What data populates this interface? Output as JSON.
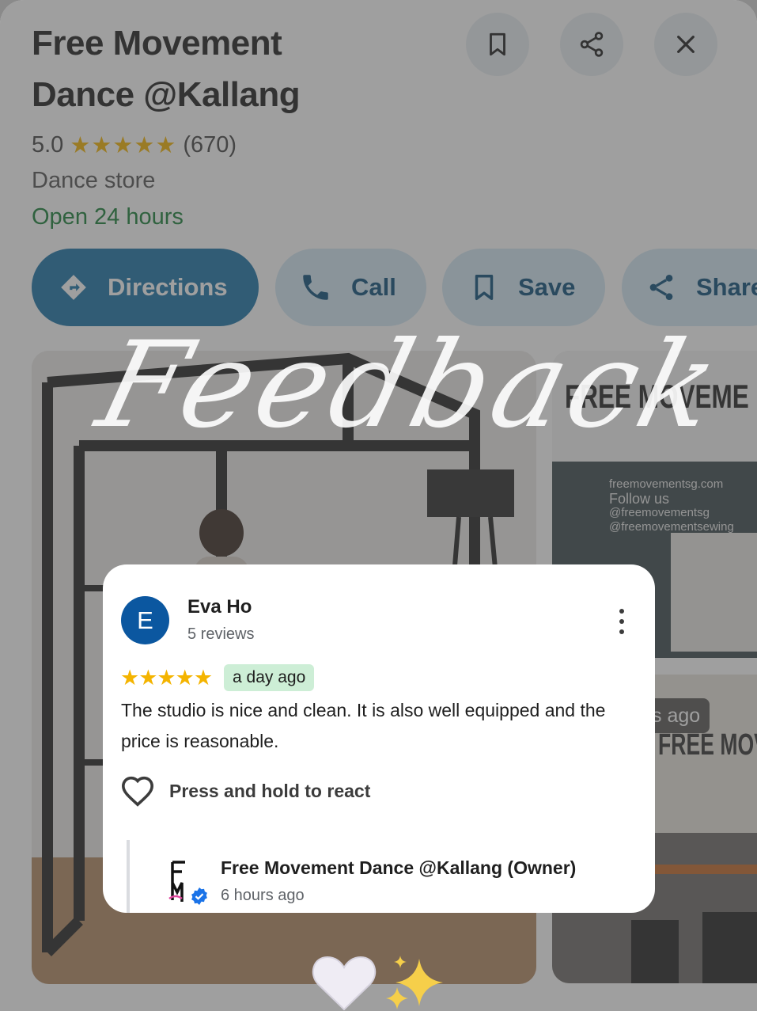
{
  "place": {
    "name_line1": "Free Movement",
    "name_line2": "Dance @Kallang",
    "rating": "5.0",
    "stars": "★★★★★",
    "review_count": "(670)",
    "category": "Dance store",
    "hours": "Open 24 hours"
  },
  "top_icons": [
    "bookmark-icon",
    "share-icon",
    "close-icon"
  ],
  "actions": {
    "directions": "Directions",
    "call": "Call",
    "save": "Save",
    "share": "Share"
  },
  "photos": {
    "storefront_sign": "FREE MOVEME",
    "storefront_sign_lower": "FREE MOVEM",
    "website": "freemovementsg.com",
    "follow": "Follow us",
    "handle1": "@freemovementsg",
    "handle2": "@freemovementsewing",
    "chip_suffix": "s ago"
  },
  "overlay_title": "Feedback",
  "review": {
    "avatar_letter": "E",
    "author": "Eva Ho",
    "author_reviews": "5 reviews",
    "stars": "★★★★★",
    "time": "a day ago",
    "text": "The studio is nice and clean.  It is also well equipped and the price is reasonable.",
    "react_label": "Press and hold to react",
    "owner_name": "Free Movement Dance @Kallang (Owner)",
    "owner_time": "6 hours ago"
  },
  "colors": {
    "star": "#f4b400",
    "open": "#188038",
    "primary_button": "#1a73a8",
    "tonal_button": "#d3e8f5",
    "avatar": "#0b57a0",
    "chip": "#cdeed6"
  }
}
